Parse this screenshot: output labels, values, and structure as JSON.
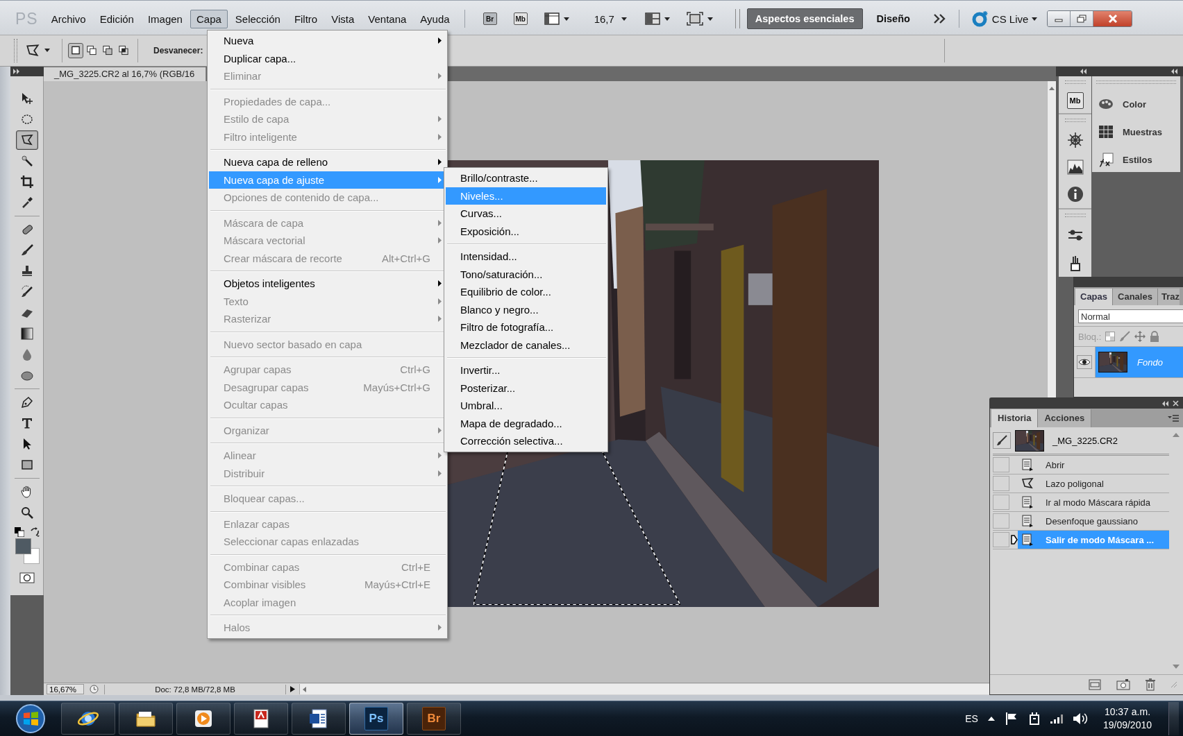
{
  "menu_bar": {
    "logo": "PS",
    "items": [
      {
        "label": "Archivo",
        "selected": false
      },
      {
        "label": "Edición",
        "selected": false
      },
      {
        "label": "Imagen",
        "selected": false
      },
      {
        "label": "Capa",
        "selected": true
      },
      {
        "label": "Selección",
        "selected": false
      },
      {
        "label": "Filtro",
        "selected": false
      },
      {
        "label": "Vista",
        "selected": false
      },
      {
        "label": "Ventana",
        "selected": false
      },
      {
        "label": "Ayuda",
        "selected": false
      }
    ],
    "bridge_button": "Br",
    "mini_bridge_button": "Mb",
    "zoom_value": "16,7",
    "workspaces": [
      {
        "label": "Aspectos esenciales",
        "selected": true
      },
      {
        "label": "Diseño",
        "selected": false
      }
    ],
    "cs_live": "CS Live"
  },
  "options_bar": {
    "selection_modes": [
      {
        "selected": true
      },
      {
        "selected": false
      },
      {
        "selected": false
      },
      {
        "selected": false
      }
    ],
    "feather_label": "Desvanecer:"
  },
  "toolbox": {
    "tools": [
      {
        "selected": false
      },
      {
        "selected": false
      },
      {
        "selected": true
      },
      {
        "selected": false
      },
      {
        "selected": false
      },
      {
        "selected": false
      },
      {
        "selected": false
      },
      {
        "selected": false
      },
      {
        "selected": false
      },
      {
        "selected": false
      },
      {
        "selected": false
      },
      {
        "selected": false
      },
      {
        "selected": false
      },
      {
        "selected": false
      },
      {
        "selected": false
      },
      {
        "selected": false
      },
      {
        "selected": false
      },
      {
        "selected": false
      },
      {
        "selected": false
      },
      {
        "selected": false
      }
    ]
  },
  "document": {
    "tab_title": "_MG_3225.CR2 al 16,7% (RGB/16",
    "zoom": "16,67%",
    "doc_info": "Doc: 72,8 MB/72,8 MB"
  },
  "layer_menu": {
    "items": [
      {
        "kind": "item",
        "label": "Nueva",
        "submenu": true,
        "disabled": false,
        "selected": false
      },
      {
        "kind": "item",
        "label": "Duplicar capa...",
        "submenu": false,
        "disabled": false,
        "selected": false
      },
      {
        "kind": "item",
        "label": "Eliminar",
        "submenu": true,
        "disabled": true,
        "selected": false
      },
      {
        "kind": "separator"
      },
      {
        "kind": "item",
        "label": "Propiedades de capa...",
        "submenu": false,
        "disabled": true,
        "selected": false
      },
      {
        "kind": "item",
        "label": "Estilo de capa",
        "submenu": true,
        "disabled": true,
        "selected": false
      },
      {
        "kind": "item",
        "label": "Filtro inteligente",
        "submenu": true,
        "disabled": true,
        "selected": false
      },
      {
        "kind": "separator"
      },
      {
        "kind": "item",
        "label": "Nueva capa de relleno",
        "submenu": true,
        "disabled": false,
        "selected": false
      },
      {
        "kind": "item",
        "label": "Nueva capa de ajuste",
        "submenu": true,
        "disabled": false,
        "selected": true
      },
      {
        "kind": "item",
        "label": "Opciones de contenido de capa...",
        "submenu": false,
        "disabled": true,
        "selected": false
      },
      {
        "kind": "separator"
      },
      {
        "kind": "item",
        "label": "Máscara de capa",
        "submenu": true,
        "disabled": true,
        "selected": false
      },
      {
        "kind": "item",
        "label": "Máscara vectorial",
        "submenu": true,
        "disabled": true,
        "selected": false
      },
      {
        "kind": "item",
        "label": "Crear máscara de recorte",
        "shortcut": "Alt+Ctrl+G",
        "submenu": false,
        "disabled": true,
        "selected": false
      },
      {
        "kind": "separator"
      },
      {
        "kind": "item",
        "label": "Objetos inteligentes",
        "submenu": true,
        "disabled": false,
        "selected": false
      },
      {
        "kind": "item",
        "label": "Texto",
        "submenu": true,
        "disabled": true,
        "selected": false
      },
      {
        "kind": "item",
        "label": "Rasterizar",
        "submenu": true,
        "disabled": true,
        "selected": false
      },
      {
        "kind": "separator"
      },
      {
        "kind": "item",
        "label": "Nuevo sector basado en capa",
        "submenu": false,
        "disabled": true,
        "selected": false
      },
      {
        "kind": "separator"
      },
      {
        "kind": "item",
        "label": "Agrupar capas",
        "shortcut": "Ctrl+G",
        "submenu": false,
        "disabled": true,
        "selected": false
      },
      {
        "kind": "item",
        "label": "Desagrupar capas",
        "shortcut": "Mayús+Ctrl+G",
        "submenu": false,
        "disabled": true,
        "selected": false
      },
      {
        "kind": "item",
        "label": "Ocultar capas",
        "submenu": false,
        "disabled": true,
        "selected": false
      },
      {
        "kind": "separator"
      },
      {
        "kind": "item",
        "label": "Organizar",
        "submenu": true,
        "disabled": true,
        "selected": false
      },
      {
        "kind": "separator"
      },
      {
        "kind": "item",
        "label": "Alinear",
        "submenu": true,
        "disabled": true,
        "selected": false
      },
      {
        "kind": "item",
        "label": "Distribuir",
        "submenu": true,
        "disabled": true,
        "selected": false
      },
      {
        "kind": "separator"
      },
      {
        "kind": "item",
        "label": "Bloquear capas...",
        "submenu": false,
        "disabled": true,
        "selected": false
      },
      {
        "kind": "separator"
      },
      {
        "kind": "item",
        "label": "Enlazar capas",
        "submenu": false,
        "disabled": true,
        "selected": false
      },
      {
        "kind": "item",
        "label": "Seleccionar capas enlazadas",
        "submenu": false,
        "disabled": true,
        "selected": false
      },
      {
        "kind": "separator"
      },
      {
        "kind": "item",
        "label": "Combinar capas",
        "shortcut": "Ctrl+E",
        "submenu": false,
        "disabled": true,
        "selected": false
      },
      {
        "kind": "item",
        "label": "Combinar visibles",
        "shortcut": "Mayús+Ctrl+E",
        "submenu": false,
        "disabled": true,
        "selected": false
      },
      {
        "kind": "item",
        "label": "Acoplar imagen",
        "submenu": false,
        "disabled": true,
        "selected": false
      },
      {
        "kind": "separator"
      },
      {
        "kind": "item",
        "label": "Halos",
        "submenu": true,
        "disabled": true,
        "selected": false
      }
    ]
  },
  "adjustment_submenu": {
    "items": [
      {
        "kind": "item",
        "label": "Brillo/contraste...",
        "submenu": false,
        "disabled": false,
        "selected": false
      },
      {
        "kind": "item",
        "label": "Niveles...",
        "submenu": false,
        "disabled": false,
        "selected": true
      },
      {
        "kind": "item",
        "label": "Curvas...",
        "submenu": false,
        "disabled": false,
        "selected": false
      },
      {
        "kind": "item",
        "label": "Exposición...",
        "submenu": false,
        "disabled": false,
        "selected": false
      },
      {
        "kind": "separator"
      },
      {
        "kind": "item",
        "label": "Intensidad...",
        "submenu": false,
        "disabled": false,
        "selected": false
      },
      {
        "kind": "item",
        "label": "Tono/saturación...",
        "submenu": false,
        "disabled": false,
        "selected": false
      },
      {
        "kind": "item",
        "label": "Equilibrio de color...",
        "submenu": false,
        "disabled": false,
        "selected": false
      },
      {
        "kind": "item",
        "label": "Blanco y negro...",
        "submenu": false,
        "disabled": false,
        "selected": false
      },
      {
        "kind": "item",
        "label": "Filtro de fotografía...",
        "submenu": false,
        "disabled": false,
        "selected": false
      },
      {
        "kind": "item",
        "label": "Mezclador de canales...",
        "submenu": false,
        "disabled": false,
        "selected": false
      },
      {
        "kind": "separator"
      },
      {
        "kind": "item",
        "label": "Invertir...",
        "submenu": false,
        "disabled": false,
        "selected": false
      },
      {
        "kind": "item",
        "label": "Posterizar...",
        "submenu": false,
        "disabled": false,
        "selected": false
      },
      {
        "kind": "item",
        "label": "Umbral...",
        "submenu": false,
        "disabled": false,
        "selected": false
      },
      {
        "kind": "item",
        "label": "Mapa de degradado...",
        "submenu": false,
        "disabled": false,
        "selected": false
      },
      {
        "kind": "item",
        "label": "Corrección selectiva...",
        "submenu": false,
        "disabled": false,
        "selected": false
      }
    ]
  },
  "dock": {
    "mini_bridge": "Mb",
    "panels": [
      {
        "label": "Color"
      },
      {
        "label": "Muestras"
      },
      {
        "label": "Estilos"
      }
    ]
  },
  "layers_panel": {
    "tabs": [
      {
        "label": "Capas",
        "selected": true
      },
      {
        "label": "Canales",
        "selected": false
      },
      {
        "label": "Traz",
        "selected": false
      }
    ],
    "blend_mode": "Normal",
    "lock_label": "Bloq.:",
    "layers": [
      {
        "name": "Fondo",
        "visible": true,
        "selected": true
      }
    ]
  },
  "history_panel": {
    "tabs": [
      {
        "label": "Historia",
        "selected": true
      },
      {
        "label": "Acciones",
        "selected": false
      }
    ],
    "snapshot": "_MG_3225.CR2",
    "states": [
      {
        "kind": "command",
        "label": "Abrir",
        "selected": false
      },
      {
        "kind": "tool",
        "label": "Lazo poligonal",
        "selected": false
      },
      {
        "kind": "command",
        "label": "Ir al modo Máscara rápida",
        "selected": false
      },
      {
        "kind": "command",
        "label": "Desenfoque gaussiano",
        "selected": false
      },
      {
        "kind": "command",
        "label": "Salir de modo Máscara ...",
        "selected": true
      }
    ]
  },
  "taskbar": {
    "apps": [
      {
        "active": false
      },
      {
        "active": false
      },
      {
        "active": false
      },
      {
        "active": false
      },
      {
        "active": false
      },
      {
        "label": "Ps",
        "active": true
      },
      {
        "label": "Br",
        "active": false
      }
    ],
    "language": "ES",
    "time": "10:37 a.m.",
    "date": "19/09/2010"
  }
}
